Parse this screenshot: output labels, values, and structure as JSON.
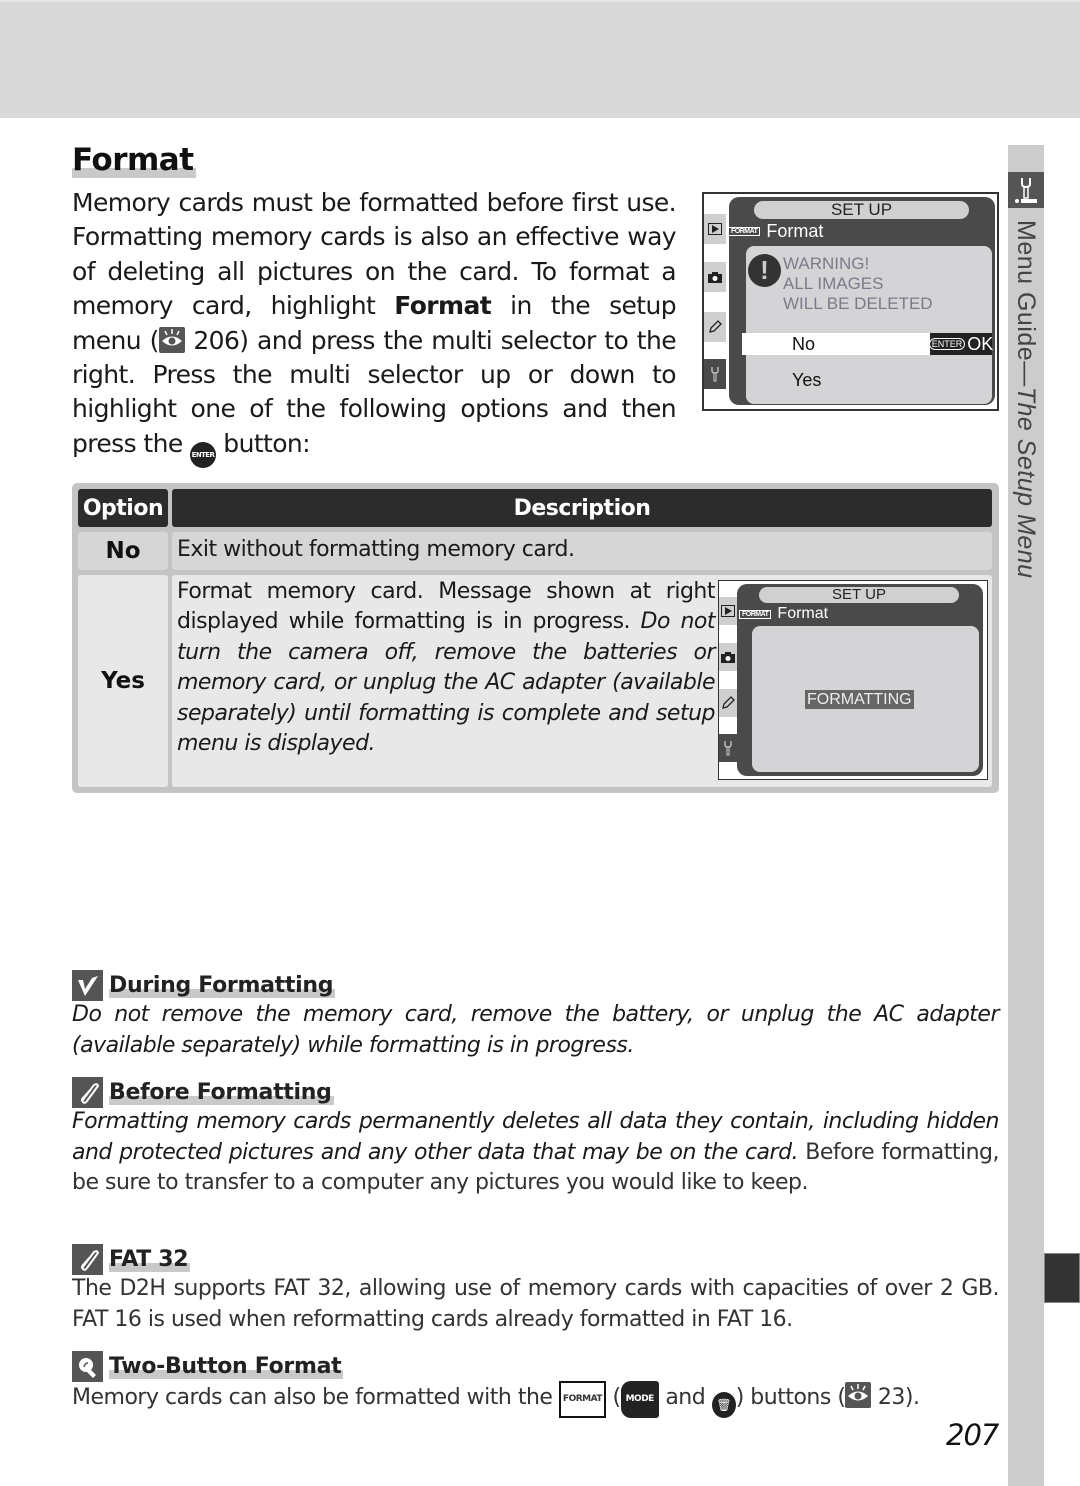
{
  "header_band": {},
  "side_tab": {
    "icon": "wrench-icon",
    "label_plain": "Menu Guide—",
    "label_italic": "The Setup Menu"
  },
  "title": "Format",
  "intro": {
    "part1": "Memory cards must be formatted before first use. Formatting memory cards is also an effective way of deleting all pictures on the card.  To format a memory card, highlight ",
    "bold": "Format",
    "part2": " in the setup menu (",
    "ref_icon": "eye-reference-icon",
    "ref_page": " 206",
    "part3": ") and press the multi selector to the right.  Press the multi selector up or down to highlight one of the following options and then press the ",
    "button_icon": "enter-button-icon",
    "button_label": "ENTER",
    "part4": " button:"
  },
  "lcd_warning": {
    "header": "SET  UP",
    "format_badge": "FORMAT",
    "menu_item": "Format",
    "warning_lines": [
      "WARNING!",
      "ALL IMAGES",
      "WILL BE DELETED"
    ],
    "option_no": "No",
    "enter_label": "ENTER",
    "ok_label": "OK",
    "option_yes": "Yes",
    "tab_icons": [
      "playback-icon",
      "camera-icon",
      "pencil-icon",
      "wrench-icon"
    ]
  },
  "table": {
    "headers": [
      "Option",
      "Description"
    ],
    "rows": [
      {
        "option": "No",
        "description": "Exit without formatting memory card."
      },
      {
        "option": "Yes",
        "description_plain": "Format memory card.  Message shown at right displayed while formatting is in progress.  ",
        "description_italic": "Do not turn the camera off, remove the batteries or memory card, or unplug the AC adapter (available separately) until formatting is complete and setup menu is displayed."
      }
    ]
  },
  "lcd_formatting": {
    "header": "SET  UP",
    "format_badge": "FORMAT",
    "menu_item": "Format",
    "status": "FORMATTING"
  },
  "notes": [
    {
      "icon": "checkmark-icon",
      "title": "During Formatting",
      "body_italic": "Do not remove the memory card, remove the battery, or unplug the AC adapter (available separately) while formatting is in progress."
    },
    {
      "icon": "paperclip-icon",
      "title": "Before Formatting",
      "body_italic": "Formatting memory cards permanently deletes all data they contain, including hidden and protected pictures and any other data that may be on the card.",
      "body_plain": " Before formatting, be sure to transfer to a computer any pictures you would like to keep."
    },
    {
      "icon": "paperclip-icon",
      "title": "FAT 32",
      "body": "The D2H supports FAT 32, allowing use of memory cards with capacities of over 2 GB. FAT 16 is used when reformatting cards already formatted in FAT 16."
    },
    {
      "icon": "magnifier-tip-icon",
      "title": "Two-Button Format",
      "body_part1": "Memory cards can also be formatted with the ",
      "format_icon_label": "FORMAT",
      "body_part2": " (",
      "mode_icon_label": "MODE",
      "body_part3": " and ",
      "trash_icon": "trash-button-icon",
      "body_part4": ") buttons (",
      "ref_icon": "eye-reference-icon",
      "ref_page": " 23",
      "body_part5": ")."
    }
  ],
  "page_number": "207"
}
